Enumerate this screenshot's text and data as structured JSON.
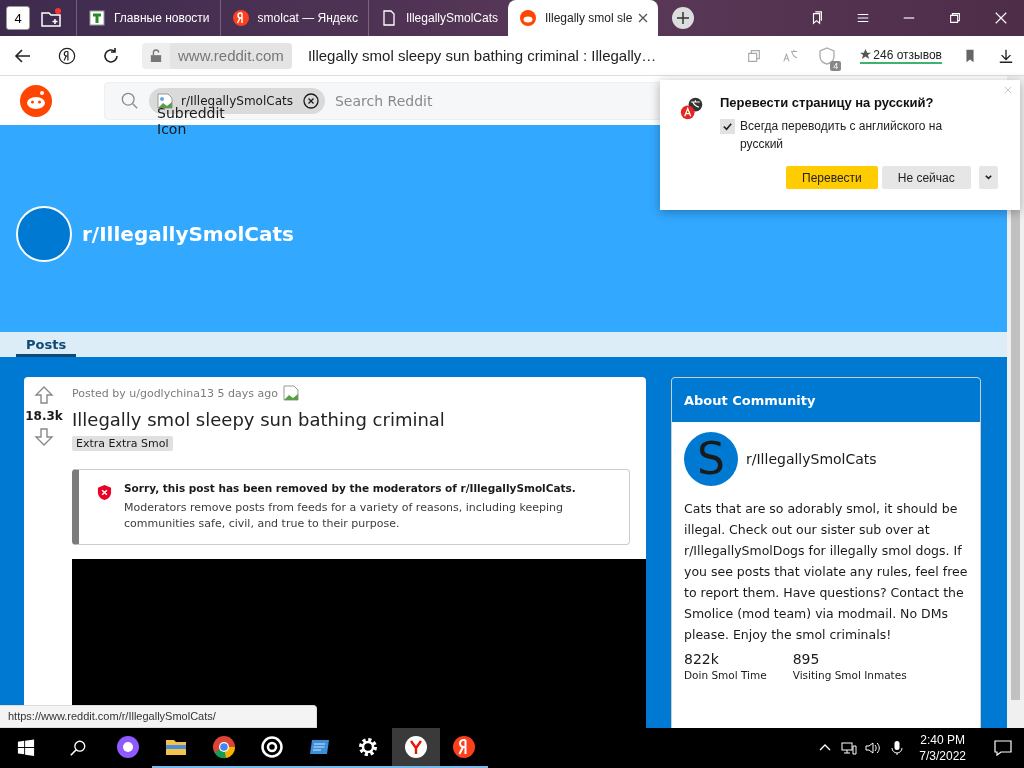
{
  "browser": {
    "home_count": "4",
    "tabs": [
      {
        "title": "Главные новости",
        "kind": "news",
        "selected": false
      },
      {
        "title": "smolcat — Яндекс",
        "kind": "yandex",
        "selected": false
      },
      {
        "title": "IllegallySmolCats",
        "kind": "page",
        "selected": false
      },
      {
        "title": "Illegally smol sle",
        "kind": "reddit",
        "selected": true
      }
    ],
    "domain": "www.reddit.com",
    "page_title": "Illegally smol sleepy sun bathing criminal : Illegally…",
    "protect_badge": "4",
    "reviews": "246 отзывов"
  },
  "reddit": {
    "search": {
      "chip": "r/IllegallySmolCats",
      "placeholder": "Search Reddit",
      "broken_image_alt": "Subreddit Icon"
    },
    "banner_title": "r/IllegallySmolCats",
    "tabs": [
      {
        "label": "Posts",
        "selected": true
      }
    ],
    "post": {
      "votes": "18.3k",
      "meta": "Posted by u/godlychina13 5 days ago",
      "title": "Illegally smol sleepy sun bathing criminal",
      "flair": "Extra Extra Smol",
      "notice_title": "Sorry, this post has been removed by the moderators of r/IllegallySmolCats.",
      "notice_body": "Moderators remove posts from feeds for a variety of reasons, including keeping communities safe, civil, and true to their purpose."
    },
    "about": {
      "header": "About Community",
      "avatar_letter": "S",
      "name": "r/IllegallySmolCats",
      "description": "Cats that are so adorably smol, it should be illegal. Check out our sister sub over at r/IllegallySmolDogs for illegally smol dogs. If you see posts that violate any rules, feel free to report them. Have questions? Contact the Smolice (mod team) via modmail. No DMs please. Enjoy the smol criminals!",
      "stats": [
        {
          "value": "822k",
          "label": "Doin Smol Time"
        },
        {
          "value": "895",
          "label": "Visiting Smol Inmates"
        }
      ]
    }
  },
  "status_url": "https://www.reddit.com/r/IllegallySmolCats/",
  "translate_popup": {
    "title": "Перевести страницу на русский?",
    "always": {
      "label": "Всегда переводить с английского на русский",
      "checked": true
    },
    "buttons": [
      {
        "label": "Перевести",
        "kind": "primary"
      },
      {
        "label": "Не сейчас",
        "kind": "secondary"
      }
    ]
  },
  "taskbar": {
    "apps": [
      {
        "kind": "alice",
        "selected": false
      },
      {
        "kind": "explorer",
        "selected": false
      },
      {
        "kind": "chrome",
        "selected": false
      },
      {
        "kind": "ring",
        "selected": false
      },
      {
        "kind": "notes",
        "selected": false
      },
      {
        "kind": "settings",
        "selected": false
      },
      {
        "kind": "ybrowser",
        "selected": true
      },
      {
        "kind": "yandex",
        "selected": false
      }
    ],
    "time": "2:40 PM",
    "date": "7/3/2022"
  }
}
